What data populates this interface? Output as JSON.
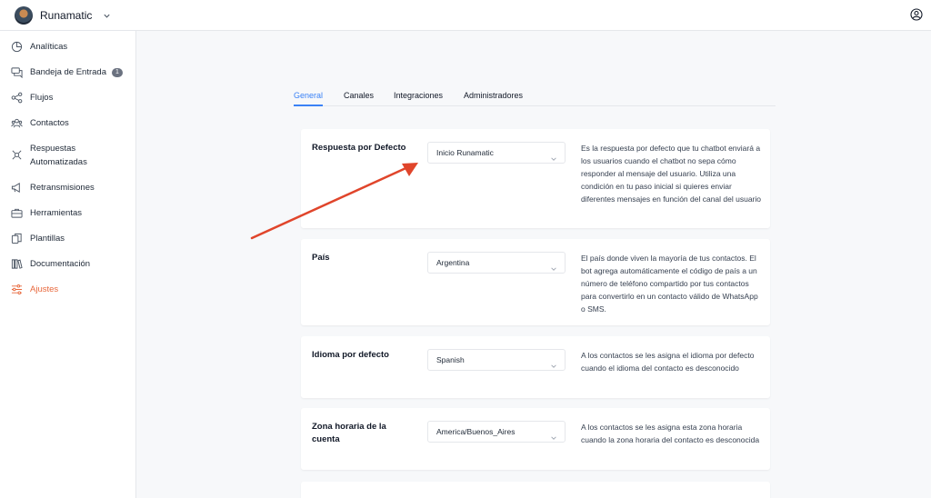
{
  "app": {
    "name": "Runamatic",
    "logo_icon": "runamatic-logo-icon",
    "chevron_icon": "chevron-down-icon",
    "user_icon": "user-circle-icon"
  },
  "sidebar": {
    "items": [
      {
        "label": "Analíticas",
        "icon": "chart-pie-icon"
      },
      {
        "label": "Bandeja de Entrada",
        "icon": "inbox-chat-icon",
        "badge": "1"
      },
      {
        "label": "Flujos",
        "icon": "flow-share-icon"
      },
      {
        "label": "Contactos",
        "icon": "users-icon"
      },
      {
        "label": "Respuestas Automatizadas",
        "icon": "auto-reply-icon"
      },
      {
        "label": "Retransmisiones",
        "icon": "megaphone-icon"
      },
      {
        "label": "Herramientas",
        "icon": "toolbox-icon"
      },
      {
        "label": "Plantillas",
        "icon": "templates-icon"
      },
      {
        "label": "Documentación",
        "icon": "books-icon"
      },
      {
        "label": "Ajustes",
        "icon": "sliders-icon",
        "active": true
      }
    ]
  },
  "tabs": [
    {
      "label": "General",
      "active": true
    },
    {
      "label": "Canales"
    },
    {
      "label": "Integraciones"
    },
    {
      "label": "Administradores"
    }
  ],
  "settings": [
    {
      "label": "Respuesta por Defecto",
      "value": "Inicio Runamatic",
      "description": "Es la respuesta por defecto que tu chatbot enviará a los usuarios cuando el chatbot no sepa cómo responder al mensaje del usuario. Utiliza una condición en tu paso inicial si quieres enviar diferentes mensajes en función del canal del usuario"
    },
    {
      "label": "País",
      "value": "Argentina",
      "description": "El país donde viven la mayoría de tus contactos. El bot agrega automáticamente el código de país a un número de teléfono compartido por tus contactos para convertirlo en un contacto válido de WhatsApp o SMS."
    },
    {
      "label": "Idioma por defecto",
      "value": "Spanish",
      "description": "A los contactos se les asigna el idioma por defecto cuando el idioma del contacto es desconocido"
    },
    {
      "label": "Zona horaria de la cuenta",
      "value": "America/Buenos_Aires",
      "description": "A los contactos se les asigna esta zona horaria cuando la zona horaria del contacto es desconocida"
    }
  ],
  "colors": {
    "accent_orange": "#e8683c",
    "tab_blue": "#3b82f6",
    "annotation_arrow": "#e0452b"
  }
}
